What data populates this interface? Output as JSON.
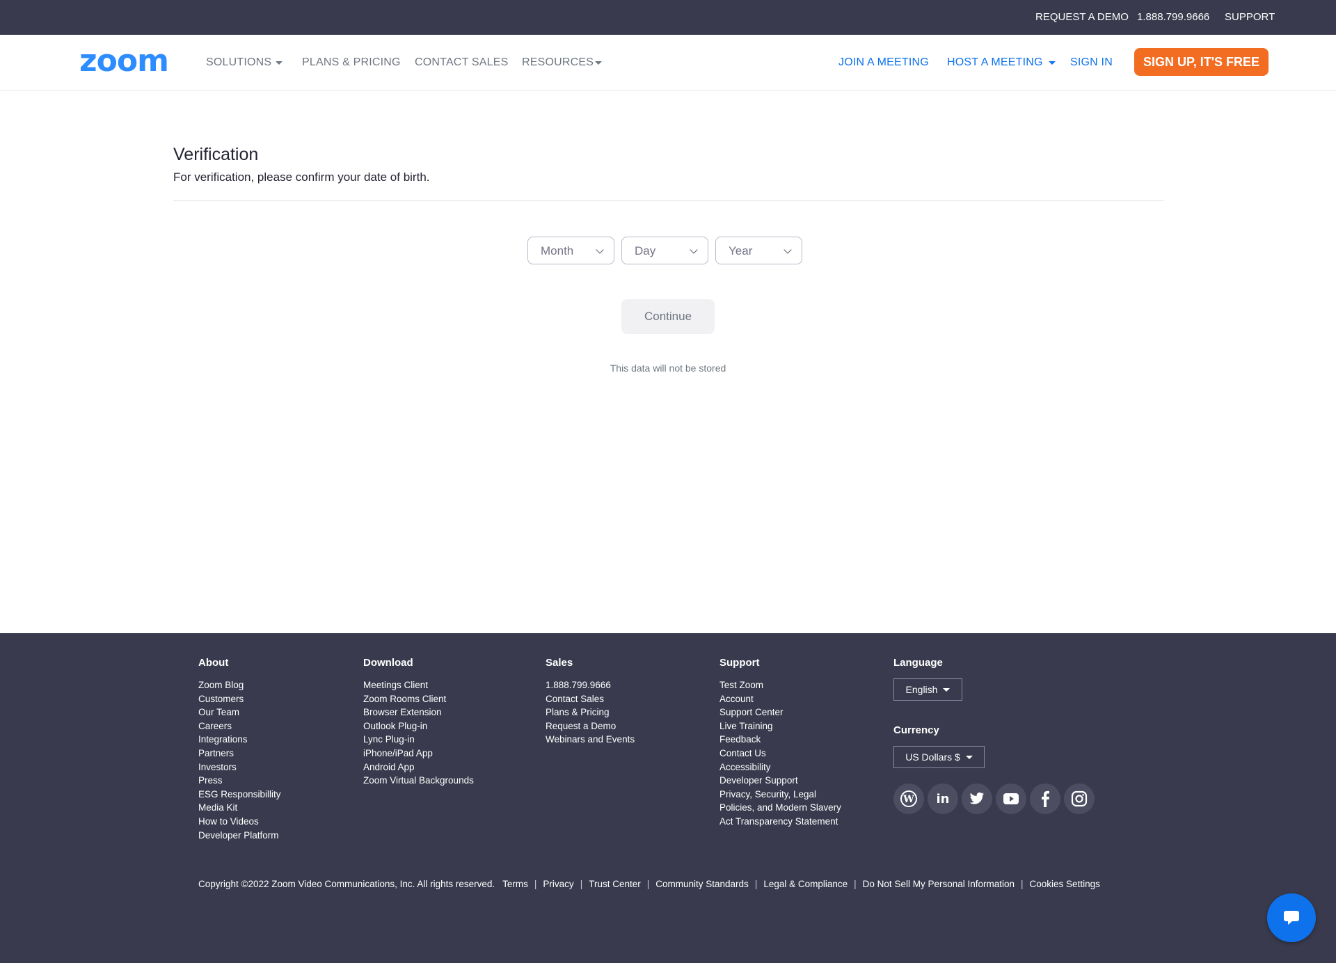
{
  "topbar": {
    "request_demo": "REQUEST A DEMO",
    "phone": "1.888.799.9666",
    "support": "SUPPORT"
  },
  "nav": {
    "logo_text": "zoom",
    "solutions": "SOLUTIONS",
    "plans_pricing": "PLANS & PRICING",
    "contact_sales": "CONTACT SALES",
    "resources": "RESOURCES",
    "join_meeting": "JOIN A MEETING",
    "host_meeting": "HOST A MEETING",
    "sign_in": "SIGN IN",
    "sign_up": "SIGN UP, IT'S FREE",
    "colors": {
      "brand_blue": "#0e72ed",
      "signup_orange": "#f26d21"
    }
  },
  "verification": {
    "title": "Verification",
    "subtitle": "For verification, please confirm your date of birth.",
    "month_label": "Month",
    "day_label": "Day",
    "year_label": "Year",
    "continue_label": "Continue",
    "note": "This data will not be stored"
  },
  "footer": {
    "about": {
      "heading": "About",
      "links": [
        "Zoom Blog",
        "Customers",
        "Our Team",
        "Careers",
        "Integrations",
        "Partners",
        "Investors",
        "Press",
        "ESG Responsibillity",
        "Media Kit",
        "How to Videos",
        "Developer Platform"
      ]
    },
    "download": {
      "heading": "Download",
      "links": [
        "Meetings Client",
        "Zoom Rooms Client",
        "Browser Extension",
        "Outlook Plug-in",
        "Lync Plug-in",
        "iPhone/iPad App",
        "Android App",
        "Zoom Virtual Backgrounds"
      ]
    },
    "sales": {
      "heading": "Sales",
      "links": [
        "1.888.799.9666",
        "Contact Sales",
        "Plans & Pricing",
        "Request a Demo",
        "Webinars and Events"
      ]
    },
    "support": {
      "heading": "Support",
      "links": [
        "Test Zoom",
        "Account",
        "Support Center",
        "Live Training",
        "Feedback",
        "Contact Us",
        "Accessibility",
        "Developer Support",
        "Privacy, Security, Legal",
        "Policies, and Modern Slavery",
        "Act Transparency Statement"
      ]
    },
    "language": {
      "heading": "Language",
      "selected": "English"
    },
    "currency": {
      "heading": "Currency",
      "selected": "US Dollars $"
    },
    "socials": [
      "wordpress-icon",
      "linkedin-icon",
      "twitter-icon",
      "youtube-icon",
      "facebook-icon",
      "instagram-icon"
    ],
    "copyright": "Copyright ©2022 Zoom Video Communications, Inc. All rights reserved.",
    "legal_links": [
      "Terms",
      "Privacy",
      "Trust Center",
      "Community Standards",
      "Legal & Compliance",
      "Do Not Sell My Personal Information",
      "Cookies Settings"
    ]
  },
  "chat": {
    "icon": "chat-bubble-icon"
  }
}
